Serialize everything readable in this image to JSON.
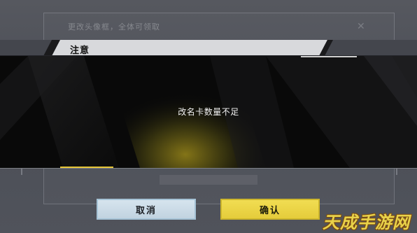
{
  "background_window": {
    "title": "更改头像框，全体可领取",
    "close_symbol": "✕"
  },
  "dialog": {
    "title": "注意",
    "message": "改名卡数量不足"
  },
  "buttons": {
    "cancel_label": "取消",
    "confirm_label": "确认"
  },
  "watermark": {
    "text": "天成手游网"
  },
  "colors": {
    "confirm_button": "#e9d143",
    "cancel_button": "#c9dae6",
    "header_band": "#d8d9dc",
    "dialog_body": "#090909",
    "accent_yellow": "#e6c637"
  }
}
